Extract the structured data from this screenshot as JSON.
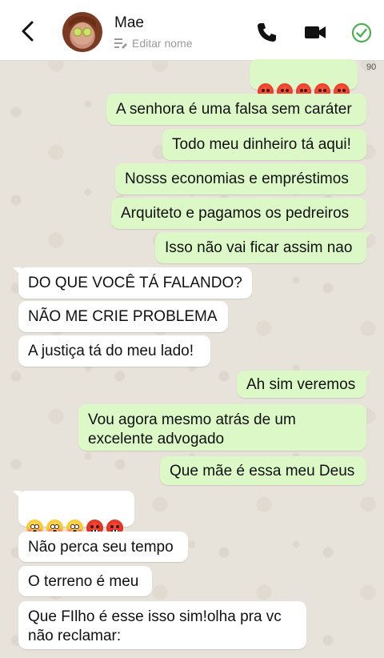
{
  "header": {
    "back_icon": "chevron-left-icon",
    "contact_name": "Mae",
    "edit_label": "Editar nome",
    "actions": [
      "phone-icon",
      "video-camera-icon",
      "check-circle-icon"
    ],
    "accent_color": "#4caf50"
  },
  "emoji_counter": "90",
  "messages": [
    {
      "side": "out",
      "emojis": [
        "angry",
        "angry",
        "angry",
        "angry",
        "angry"
      ]
    },
    {
      "side": "out",
      "text": "A senhora é uma falsa sem caráter"
    },
    {
      "side": "out",
      "text": "Todo meu dinheiro tá aqui!"
    },
    {
      "side": "out",
      "text": "Nosss economias e empréstimos"
    },
    {
      "side": "out",
      "text": "Arquiteto e pagamos os pedreiros"
    },
    {
      "side": "out",
      "text": "Isso não vai ficar assim nao"
    },
    {
      "side": "in",
      "text": "DO QUE VOCÊ TÁ FALANDO?"
    },
    {
      "side": "in",
      "text": "NÃO ME CRIE PROBLEMA"
    },
    {
      "side": "in",
      "text": "A justiça tá do meu lado!"
    },
    {
      "side": "out",
      "text": "Ah sim veremos"
    },
    {
      "side": "out",
      "text": "Vou agora mesmo atrás de um\nexcelente advogado"
    },
    {
      "side": "out",
      "text": "Que mãe é essa meu Deus"
    },
    {
      "side": "in",
      "emojis": [
        "flushed",
        "flushed",
        "flushed",
        "cursing",
        "cursing"
      ]
    },
    {
      "side": "in",
      "text": "Não perca seu tempo"
    },
    {
      "side": "in",
      "text": "O terreno é meu"
    },
    {
      "side": "in",
      "text": "Que FIlho é esse isso sim!olha pra vc\nnão reclamar:"
    }
  ],
  "colors": {
    "outgoing_bubble": "#dcf8c6",
    "incoming_bubble": "#ffffff",
    "wallpaper": "#e8e3da"
  }
}
